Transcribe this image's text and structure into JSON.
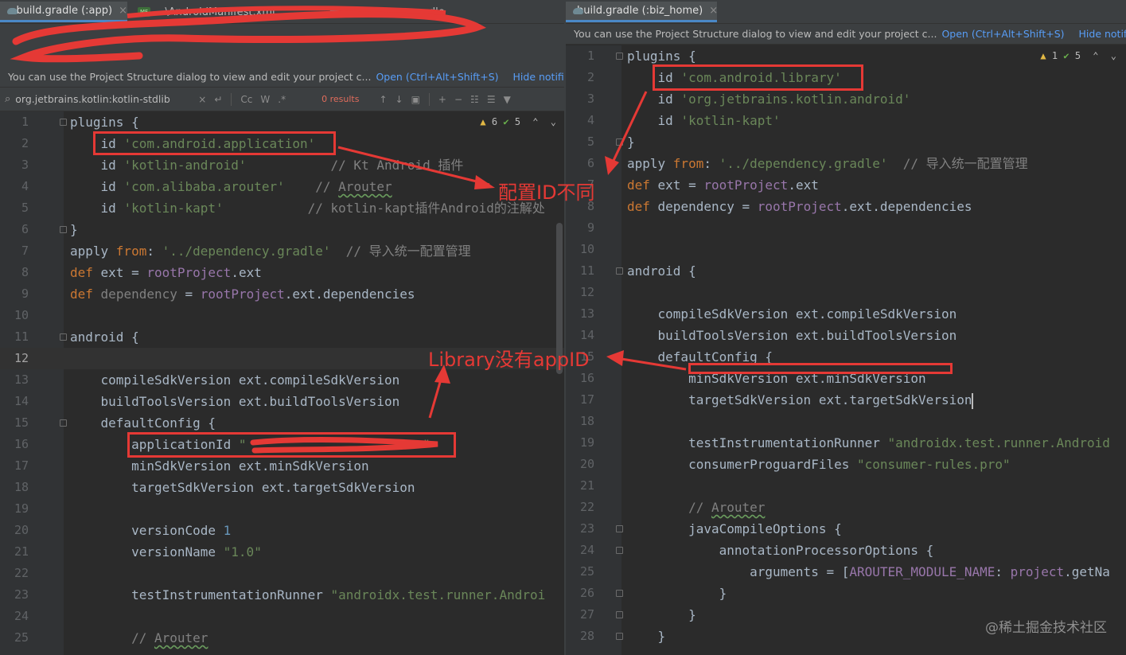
{
  "left": {
    "tabs": [
      {
        "label": "build.gradle (:app)",
        "active": true
      },
      {
        "label": "...\\AndroidManifest.xml",
        "active": false
      },
      {
        "label": "dependency.gradle",
        "active": false
      }
    ],
    "notification": {
      "message": "You can use the Project Structure dialog to view and edit your project c...",
      "open_link": "Open (Ctrl+Alt+Shift+S)",
      "hide_link": "Hide notification"
    },
    "find": {
      "query": "org.jetbrains.kotlin:kotlin-stdlib",
      "cc_toggle": "Cc",
      "w_toggle": "W",
      "regex_toggle": ".*",
      "results": "0 results"
    },
    "inspections": {
      "warnings": "6",
      "ok": "5"
    },
    "lines": [
      {
        "n": "1",
        "html": "plugins {"
      },
      {
        "n": "2",
        "html": "    id <span class=\"s\">'com.android.application'</span>"
      },
      {
        "n": "3",
        "html": "    id <span class=\"s\">'kotlin-android'</span>           <span class=\"c\">// Kt Android 插件</span>"
      },
      {
        "n": "4",
        "html": "    id <span class=\"s\">'com.alibaba.arouter'</span>    <span class=\"c\">// <span class=\"wavy\">Arouter</span></span>"
      },
      {
        "n": "5",
        "html": "    id <span class=\"s\">'kotlin-kapt'</span>           <span class=\"c\">// kotlin-kapt插件Android的注解处</span>"
      },
      {
        "n": "6",
        "html": "}"
      },
      {
        "n": "7",
        "html": "apply <span class=\"k\">from</span>: <span class=\"s\">'../dependency.gradle'</span>  <span class=\"c\">// 导入统一配置管理</span>"
      },
      {
        "n": "8",
        "html": "<span class=\"k\">def</span> ext = <span class=\"p\">rootProject</span>.ext"
      },
      {
        "n": "9",
        "html": "<span class=\"k\">def</span> <span style=\"color:#808080\">dependency</span> = <span class=\"p\">rootProject</span>.ext.dependencies"
      },
      {
        "n": "10",
        "html": ""
      },
      {
        "n": "11",
        "html": "android {"
      },
      {
        "n": "12",
        "html": ""
      },
      {
        "n": "13",
        "html": "    compileSdkVersion ext.compileSdkVersion"
      },
      {
        "n": "14",
        "html": "    buildToolsVersion ext.buildToolsVersion"
      },
      {
        "n": "15",
        "html": "    defaultConfig {"
      },
      {
        "n": "16",
        "html": "        applicationId <span class=\"s\">\"</span>                       <span class=\"s\">\"</span>"
      },
      {
        "n": "17",
        "html": "        minSdkVersion ext.minSdkVersion"
      },
      {
        "n": "18",
        "html": "        targetSdkVersion ext.targetSdkVersion"
      },
      {
        "n": "19",
        "html": ""
      },
      {
        "n": "20",
        "html": "        versionCode <span class=\"n\">1</span>"
      },
      {
        "n": "21",
        "html": "        versionName <span class=\"s\">\"1.0\"</span>"
      },
      {
        "n": "22",
        "html": ""
      },
      {
        "n": "23",
        "html": "        testInstrumentationRunner <span class=\"s\">\"androidx.test.runner.Androi</span>"
      },
      {
        "n": "24",
        "html": ""
      },
      {
        "n": "25",
        "html": "        <span class=\"c\">// <span class=\"wavy\">Arouter</span></span>"
      }
    ]
  },
  "right": {
    "tabs": [
      {
        "label": "build.gradle (:biz_home)",
        "active": true
      }
    ],
    "notification": {
      "message": "You can use the Project Structure dialog to view and edit your project c...",
      "open_link": "Open (Ctrl+Alt+Shift+S)",
      "hide_link": "Hide notification"
    },
    "inspections": {
      "warnings": "1",
      "ok": "5"
    },
    "lines": [
      {
        "n": "1",
        "html": "plugins {"
      },
      {
        "n": "2",
        "html": "    id <span class=\"s\">'com.android.library'</span>"
      },
      {
        "n": "3",
        "html": "    id <span class=\"s\">'org.jetbrains.kotlin.android'</span>"
      },
      {
        "n": "4",
        "html": "    id <span class=\"s\">'kotlin-kapt'</span>"
      },
      {
        "n": "5",
        "html": "}"
      },
      {
        "n": "6",
        "html": "apply <span class=\"k\">from</span>: <span class=\"s\">'../dependency.gradle'</span>  <span class=\"c\">// 导入统一配置管理</span>"
      },
      {
        "n": "7",
        "html": "<span class=\"k\">def</span> ext = <span class=\"p\">rootProject</span>.ext"
      },
      {
        "n": "8",
        "html": "<span class=\"k\">def</span> dependency = <span class=\"p\">rootProject</span>.ext.dependencies"
      },
      {
        "n": "9",
        "html": ""
      },
      {
        "n": "10",
        "html": ""
      },
      {
        "n": "11",
        "html": "android {"
      },
      {
        "n": "12",
        "html": ""
      },
      {
        "n": "13",
        "html": "    compileSdkVersion ext.compileSdkVersion"
      },
      {
        "n": "14",
        "html": "    buildToolsVersion ext.buildToolsVersion"
      },
      {
        "n": "15",
        "html": "    defaultConfig {"
      },
      {
        "n": "16",
        "html": "        minSdkVersion ext.minSdkVersion"
      },
      {
        "n": "17",
        "html": "        targetSdkVersion ext.targetSdkVersion"
      },
      {
        "n": "18",
        "html": ""
      },
      {
        "n": "19",
        "html": "        testInstrumentationRunner <span class=\"s\">\"androidx.test.runner.Android</span>"
      },
      {
        "n": "20",
        "html": "        consumerProguardFiles <span class=\"s\">\"consumer-rules.pro\"</span>"
      },
      {
        "n": "21",
        "html": ""
      },
      {
        "n": "22",
        "html": "        <span class=\"c\">// <span class=\"wavy\">Arouter</span></span>"
      },
      {
        "n": "23",
        "html": "        javaCompileOptions {"
      },
      {
        "n": "24",
        "html": "            annotationProcessorOptions {"
      },
      {
        "n": "25",
        "html": "                arguments = [<span class=\"p\">AROUTER_MODULE_NAME</span>: <span class=\"p\">project</span>.getNa"
      },
      {
        "n": "26",
        "html": "            }"
      },
      {
        "n": "27",
        "html": "        }"
      },
      {
        "n": "28",
        "html": "    }"
      }
    ]
  },
  "annotations": {
    "id_differs": "配置ID不同",
    "library_no_appid": "Library没有appID"
  },
  "watermark": "@稀土掘金技术社区"
}
